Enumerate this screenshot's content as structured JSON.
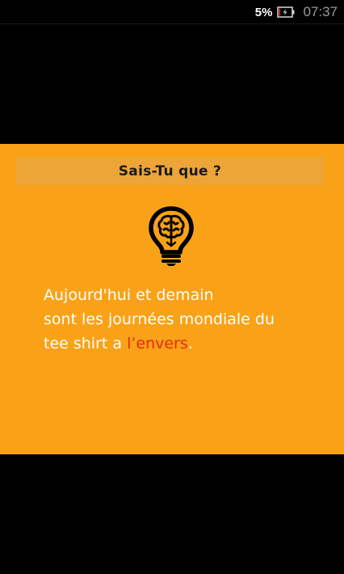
{
  "status_bar": {
    "battery_percent": "5%",
    "battery_icon": "battery-charging-icon",
    "time": "07:37"
  },
  "card": {
    "title": "Sais-Tu que ?",
    "icon": "lightbulb-brain-icon",
    "text_line1": "Aujourd'hui et demain",
    "text_line2": "sont les journées mondiale du",
    "text_line3_prefix": "tee shirt a ",
    "text_line3_highlight": "l’envers",
    "text_line3_suffix": ".",
    "colors": {
      "background": "#f9a217",
      "header": "#eda537",
      "text": "#ffffff",
      "highlight": "#e82a10"
    }
  }
}
